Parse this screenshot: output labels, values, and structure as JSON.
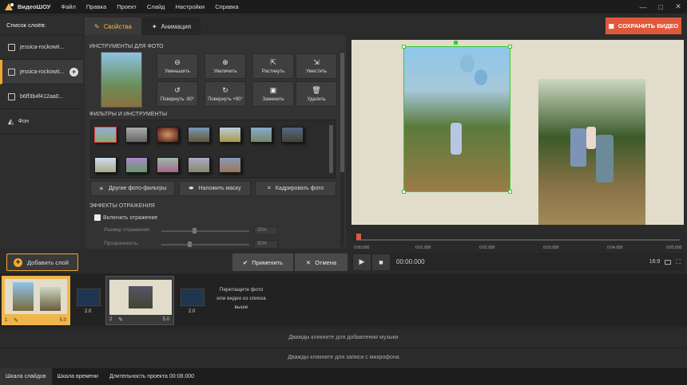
{
  "app": {
    "name": "ВидеоШОУ"
  },
  "menu": [
    "Файл",
    "Правка",
    "Проект",
    "Слайд",
    "Настройки",
    "Справка"
  ],
  "layers": {
    "title": "Список слоёв:",
    "items": [
      "jessica-rockowit...",
      "jessica-rockowit...",
      "b6ff3b4f412aa0...",
      "Фон"
    ]
  },
  "tabs": {
    "properties": "Свойства",
    "animation": "Анимация"
  },
  "photo_tools": {
    "heading": "ИНСТРУМЕНТЫ ДЛЯ ФОТО",
    "buttons": [
      "Уменьшить",
      "Увеличить",
      "Растянуть",
      "Уместить",
      "Повернуть -90°",
      "Повернуть +90°",
      "Заменить",
      "Удалить"
    ]
  },
  "filters": {
    "heading": "ФИЛЬТРЫ И ИНСТРУМЕНТЫ",
    "other_filters": "Другие фото-фильтры",
    "mask": "Наложить маску",
    "crop": "Кадрировать фото"
  },
  "reflection": {
    "heading": "ЭФФЕКТЫ ОТРАЖЕНИЯ",
    "enable": "Включить отражение",
    "size_label": "Размер отражения:",
    "size_value": "35%",
    "transparency_label": "Прозрачность:",
    "transparency_value": "30%",
    "size_level": 0.35,
    "transparency_level": 0.3
  },
  "save_button": "СОХРАНИТЬ ВИДЕО",
  "timeline": {
    "ticks": [
      "0:00.000",
      "0:01.000",
      "0:02.000",
      "0:03.000",
      "0:04.000",
      "0:05.000"
    ]
  },
  "player": {
    "time": "00:00.000",
    "aspect": "16:9"
  },
  "add_slide": "Добавить слой",
  "apply": "Применить",
  "cancel": "Отмена",
  "slides": [
    {
      "number": "1",
      "duration": "5.0"
    },
    {
      "number": "2",
      "duration": "5.0"
    }
  ],
  "transitions": [
    "2.0",
    "2.0"
  ],
  "drop_hint": "Перетащите фото или видео из списка выше",
  "music_hint": "Дважды кликните для добавления музыки",
  "mic_hint": "Дважды кликните для записи с микрофона",
  "status": {
    "slides_tab": "Шкала слайдов",
    "timeline_tab": "Шкала времени",
    "duration": "Длительность проекта 00:08.000"
  },
  "colors": {
    "accent": "#f0a830",
    "save": "#e0583a"
  }
}
